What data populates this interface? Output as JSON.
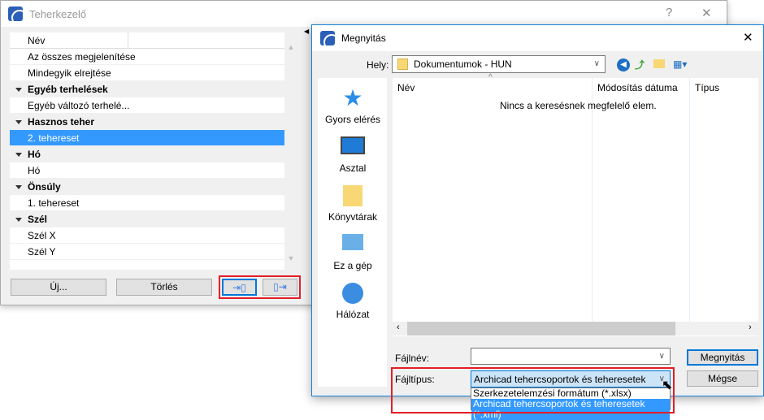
{
  "main_window": {
    "title": "Teherkezelő",
    "help": "?",
    "close": "✕",
    "list": {
      "header": "Név",
      "rows": [
        {
          "label": "Az összes megjelenítése",
          "type": "item"
        },
        {
          "label": "Mindegyik elrejtése",
          "type": "item"
        },
        {
          "label": "Egyéb terhelések",
          "type": "group"
        },
        {
          "label": "Egyéb változó terhelé...",
          "type": "item"
        },
        {
          "label": "Hasznos teher",
          "type": "group"
        },
        {
          "label": "2. tehereset",
          "type": "selected"
        },
        {
          "label": "Hó",
          "type": "group"
        },
        {
          "label": "Hó",
          "type": "item"
        },
        {
          "label": "Önsúly",
          "type": "group"
        },
        {
          "label": "1. tehereset",
          "type": "item"
        },
        {
          "label": "Szél",
          "type": "group"
        },
        {
          "label": "Szél X",
          "type": "item"
        },
        {
          "label": "Szél Y",
          "type": "item"
        }
      ]
    },
    "buttons": {
      "new": "Új...",
      "delete": "Törlés"
    }
  },
  "dialog": {
    "title": "Megnyitás",
    "close": "✕",
    "location_label": "Hely:",
    "location_value": "Dokumentumok - HUN",
    "places": [
      "Gyors elérés",
      "Asztal",
      "Könyvtárak",
      "Ez a gép",
      "Hálózat"
    ],
    "columns": [
      "Név",
      "Módosítás dátuma",
      "Típus"
    ],
    "empty_message": "Nincs a keresésnek megfelelő elem.",
    "filename_label": "Fájlnév:",
    "filename_value": "",
    "filetype_label": "Fájltípus:",
    "filetype_value": "Archicad tehercsoportok és teheresetek (*.xml)",
    "filetype_options": [
      "Szerkezetelemzési formátum (*.xlsx)",
      "Archicad tehercsoportok és teheresetek (*.xml)"
    ],
    "open_button": "Megnyitás",
    "cancel_button": "Mégse"
  }
}
